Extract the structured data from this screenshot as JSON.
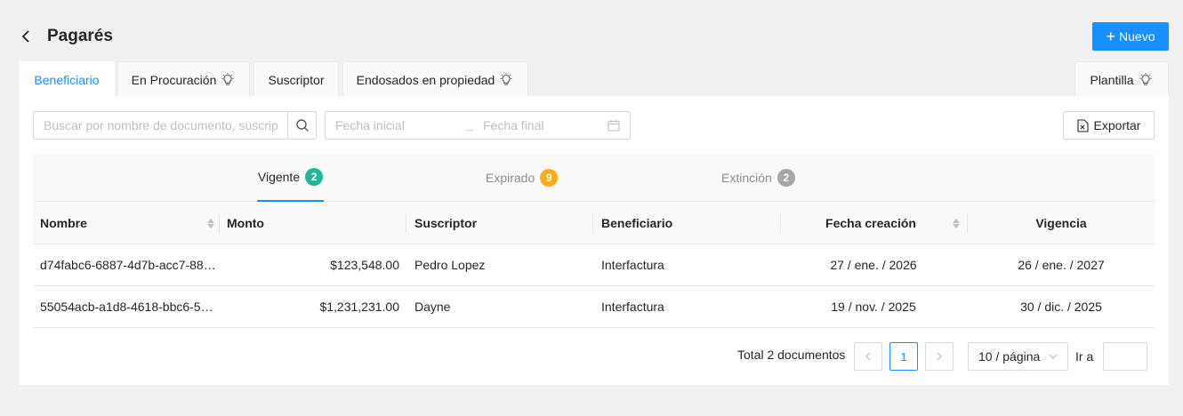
{
  "header": {
    "title": "Pagarés",
    "new_label": "Nuevo"
  },
  "tabs": [
    {
      "label": "Beneficiario",
      "active": true,
      "icon": ""
    },
    {
      "label": "En Procuración",
      "active": false,
      "icon": "lightbulb-icon"
    },
    {
      "label": "Suscriptor",
      "active": false,
      "icon": ""
    },
    {
      "label": "Endosados en propiedad",
      "active": false,
      "icon": "lightbulb-icon"
    }
  ],
  "template_tab": {
    "label": "Plantilla",
    "icon": "lightbulb-icon"
  },
  "search": {
    "placeholder": "Buscar por nombre de documento, suscriptor o beneficiario"
  },
  "date_range": {
    "start_placeholder": "Fecha inicial",
    "end_placeholder": "Fecha final",
    "separator": "→"
  },
  "export": {
    "label": "Exportar"
  },
  "status_tabs": [
    {
      "label": "Vigente",
      "count": "2",
      "color": "#20b89a",
      "active": true
    },
    {
      "label": "Expirado",
      "count": "9",
      "color": "#faad14",
      "active": false
    },
    {
      "label": "Extinción",
      "count": "2",
      "color": "#a6a6a6",
      "active": false
    }
  ],
  "table": {
    "columns": [
      "Nombre",
      "Monto",
      "Suscriptor",
      "Beneficiario",
      "Fecha creación",
      "Vigencia"
    ],
    "rows": [
      {
        "nombre": "d74fabc6-6887-4d7b-acc7-88…",
        "monto": "$123,548.00",
        "suscriptor": "Pedro Lopez",
        "beneficiario": "Interfactura",
        "fecha_creacion": "27 / ene. / 2026",
        "vigencia": "26 / ene. / 2027"
      },
      {
        "nombre": "55054acb-a1d8-4618-bbc6-5…",
        "monto": "$1,231,231.00",
        "suscriptor": "Dayne",
        "beneficiario": "Interfactura",
        "fecha_creacion": "19 / nov. / 2025",
        "vigencia": "30 / dic. / 2025"
      }
    ]
  },
  "pagination": {
    "total_label": "Total 2 documentos",
    "current_page": "1",
    "page_size": "10 / página",
    "goto_label": "Ir a",
    "goto_value": ""
  },
  "colors": {
    "accent": "#1890ff"
  }
}
